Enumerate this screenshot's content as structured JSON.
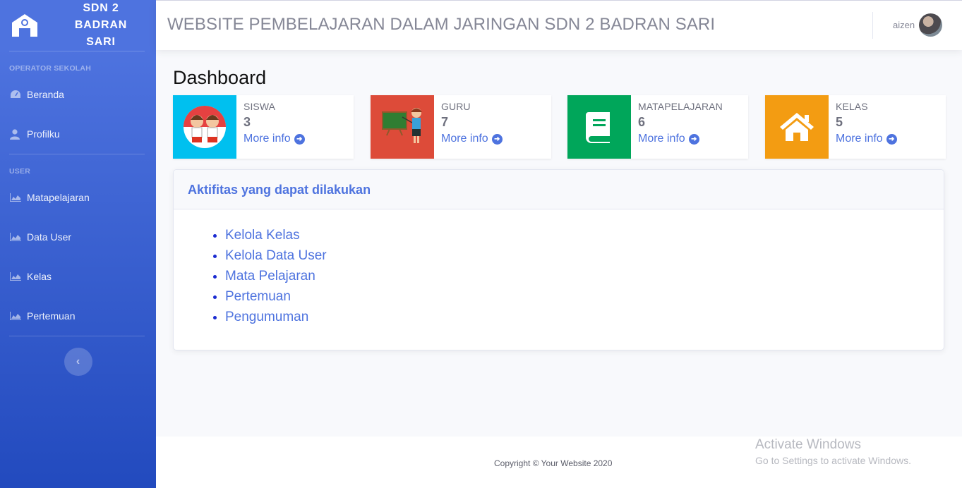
{
  "sidebar": {
    "brand": "SDN 2 BADRAN SARI",
    "brand_lines": [
      "SDN 2",
      "BADRAN",
      "SARI"
    ],
    "section_operator": "OPERATOR SEKOLAH",
    "section_user": "USER",
    "operator_items": [
      {
        "label": "Beranda",
        "icon": "tachometer-icon"
      },
      {
        "label": "Profilku",
        "icon": "user-icon"
      }
    ],
    "user_items": [
      {
        "label": "Matapelajaran",
        "icon": "area-chart-icon"
      },
      {
        "label": "Data User",
        "icon": "area-chart-icon"
      },
      {
        "label": "Kelas",
        "icon": "area-chart-icon"
      },
      {
        "label": "Pertemuan",
        "icon": "area-chart-icon"
      }
    ],
    "toggle": "‹"
  },
  "topbar": {
    "title": "WEBSITE PEMBELAJARAN DALAM JARINGAN SDN 2 BADRAN SARI",
    "user_name": "aizen"
  },
  "page_title": "Dashboard",
  "cards": [
    {
      "label": "SISWA",
      "value": "3",
      "more": "More info",
      "color": "#00c0ef",
      "icon": "students-icon"
    },
    {
      "label": "GURU",
      "value": "7",
      "more": "More info",
      "color": "#dd4b39",
      "icon": "teacher-icon"
    },
    {
      "label": "MATAPELAJARAN",
      "value": "6",
      "more": "More info",
      "color": "#00a65a",
      "icon": "book-icon"
    },
    {
      "label": "KELAS",
      "value": "5",
      "more": "More info",
      "color": "#f39c12",
      "icon": "home-icon"
    }
  ],
  "panel": {
    "title": "Aktifitas yang dapat dilakukan",
    "items": [
      "Kelola Kelas",
      "Kelola Data User",
      "Mata Pelajaran",
      "Pertemuan",
      "Pengumuman"
    ]
  },
  "footer": {
    "copyright": "Copyright © Your Website 2020"
  },
  "watermark": {
    "line1": "Activate Windows",
    "line2": "Go to Settings to activate Windows."
  }
}
